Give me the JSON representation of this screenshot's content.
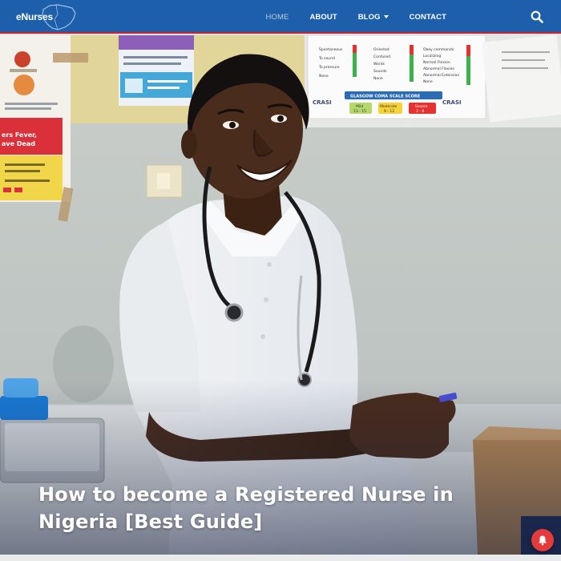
{
  "brand": {
    "logo_text": "eNurses",
    "primary_color": "#1d5fab",
    "accent_color": "#c9242c"
  },
  "nav": {
    "items": [
      {
        "label": "HOME",
        "active": true
      },
      {
        "label": "ABOUT",
        "active": false
      },
      {
        "label": "BLOG",
        "active": false,
        "has_dropdown": true
      },
      {
        "label": "CONTACT",
        "active": false
      }
    ],
    "search_icon": "search-icon"
  },
  "hero": {
    "title": "How to become a Registered Nurse in Nigeria [Best Guide]",
    "poster_right": {
      "rows_left": [
        "Spontaneous",
        "To sound",
        "To pressure",
        "None"
      ],
      "rows_mid": [
        "Oriented",
        "Confused",
        "Words",
        "Sounds",
        "None"
      ],
      "rows_right": [
        "Obey commands",
        "Localizing",
        "Normal Flexion",
        "Abnormal Flexion",
        "Abnormal Extension",
        "None"
      ],
      "banner": "GLASGOW COMA SCALE SCORE",
      "brand_left": "CRASI",
      "brand_right": "CRASI",
      "score_mild": "Mild",
      "score_mild_range": "13 - 15",
      "score_moderate": "Moderate",
      "score_moderate_range": "9 - 12",
      "score_severe": "Severe",
      "score_severe_range": "3 - 8"
    },
    "poster_left": {
      "fever_line1": "ers Fever,",
      "fever_line2": "ave Dead"
    }
  },
  "notification": {
    "icon": "bell-icon",
    "color": "#e23b3b"
  }
}
